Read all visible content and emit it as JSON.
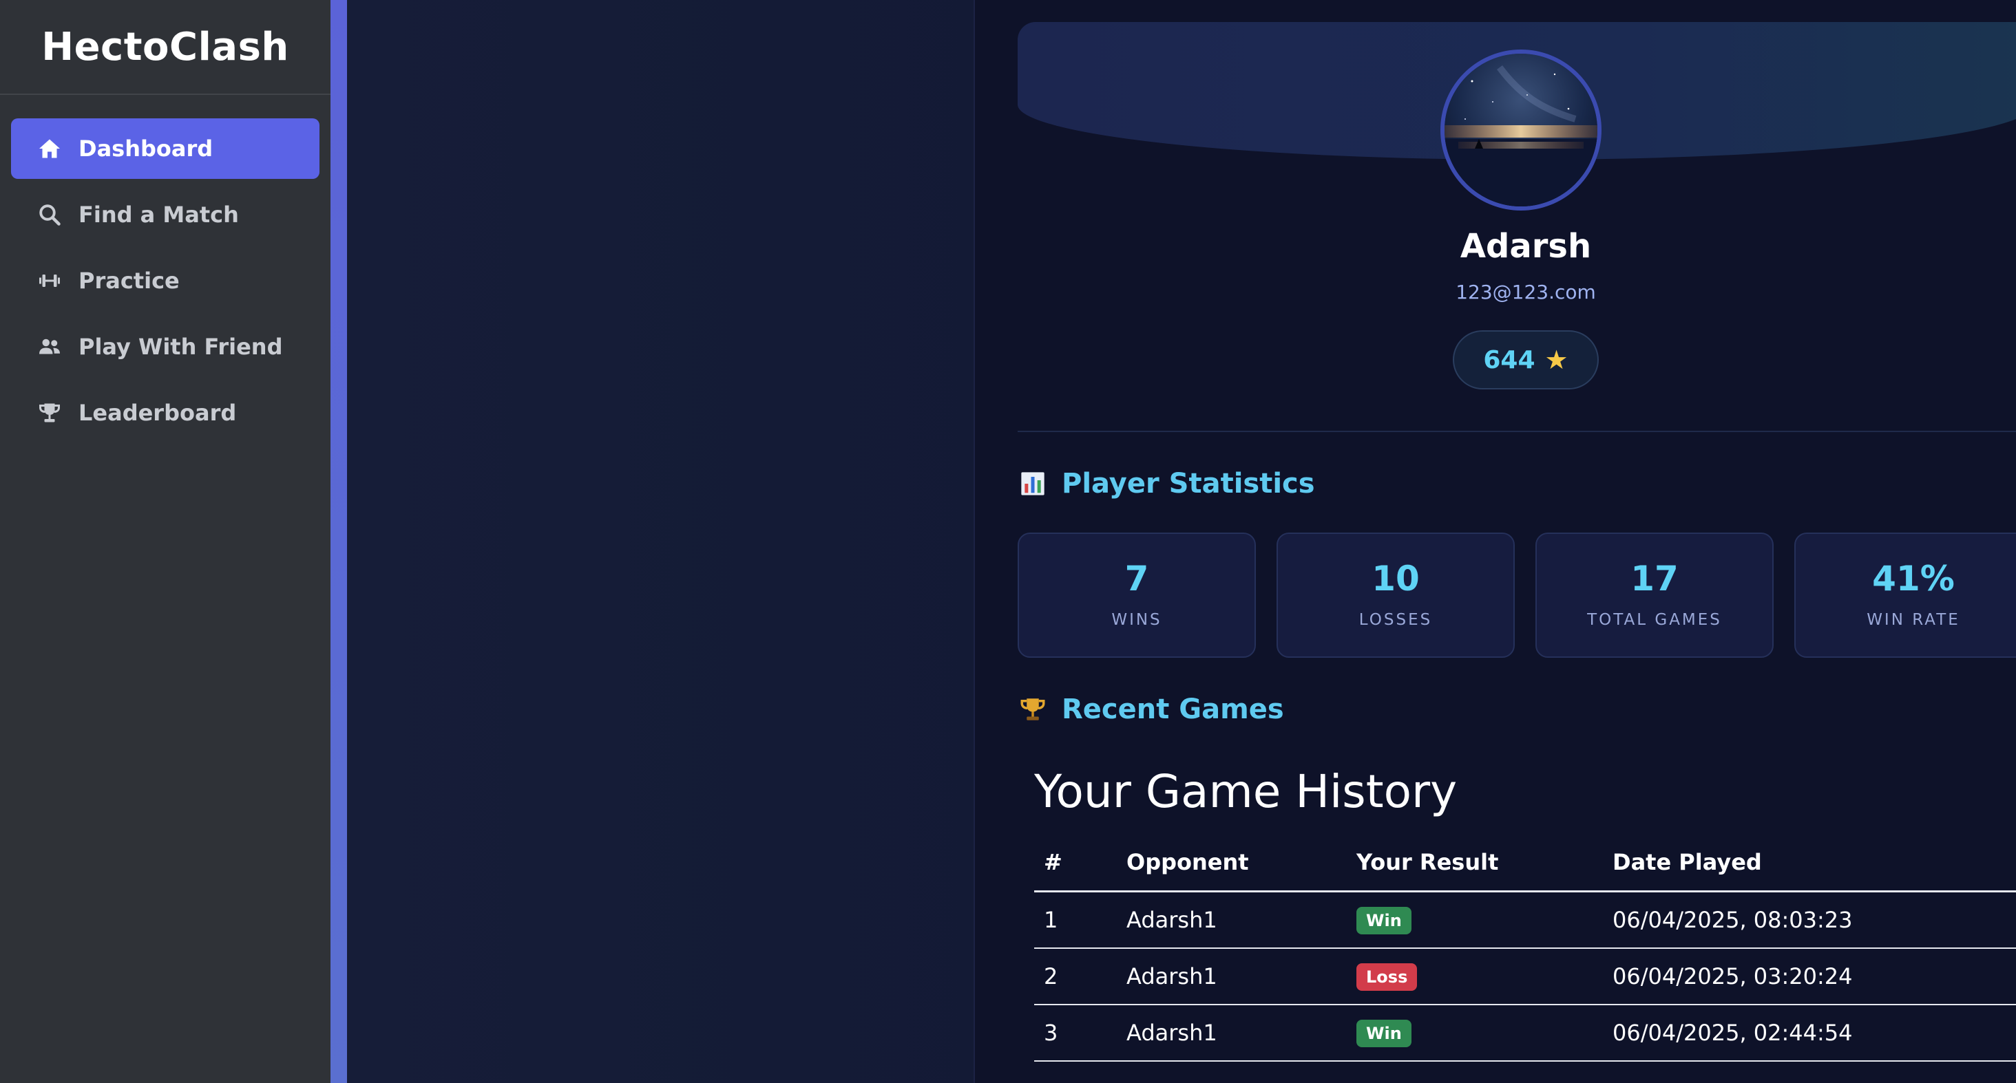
{
  "app": {
    "brand": "HectoClash"
  },
  "sidebar": {
    "items": [
      {
        "label": "Dashboard",
        "icon": "home-icon",
        "active": true
      },
      {
        "label": "Find a Match",
        "icon": "search-icon",
        "active": false
      },
      {
        "label": "Practice",
        "icon": "dumbbell-icon",
        "active": false
      },
      {
        "label": "Play With Friend",
        "icon": "users-icon",
        "active": false
      },
      {
        "label": "Leaderboard",
        "icon": "trophy-icon",
        "active": false
      }
    ]
  },
  "profile": {
    "name": "Adarsh",
    "email": "123@123.com",
    "rating": "644",
    "rating_icon": "star-icon"
  },
  "stats_section": {
    "title": "Player Statistics",
    "icon": "bar-chart-icon",
    "stats": [
      {
        "value": "7",
        "label": "WINS"
      },
      {
        "value": "10",
        "label": "LOSSES"
      },
      {
        "value": "17",
        "label": "TOTAL GAMES"
      },
      {
        "value": "41%",
        "label": "WIN RATE"
      }
    ]
  },
  "recent_section": {
    "title": "Recent Games",
    "icon": "trophy-icon"
  },
  "history": {
    "title": "Your Game History",
    "columns": [
      "#",
      "Opponent",
      "Your Result",
      "Date Played"
    ],
    "rows": [
      {
        "index": "1",
        "opponent": "Adarsh1",
        "result": "Win",
        "date": "06/04/2025, 08:03:23"
      },
      {
        "index": "2",
        "opponent": "Adarsh1",
        "result": "Loss",
        "date": "06/04/2025, 03:20:24"
      },
      {
        "index": "3",
        "opponent": "Adarsh1",
        "result": "Win",
        "date": "06/04/2025, 02:44:54"
      }
    ]
  },
  "colors": {
    "accent": "#5b63e6",
    "stat_value": "#5fd3f5",
    "win": "#2f8a52",
    "loss": "#d23c4a"
  }
}
